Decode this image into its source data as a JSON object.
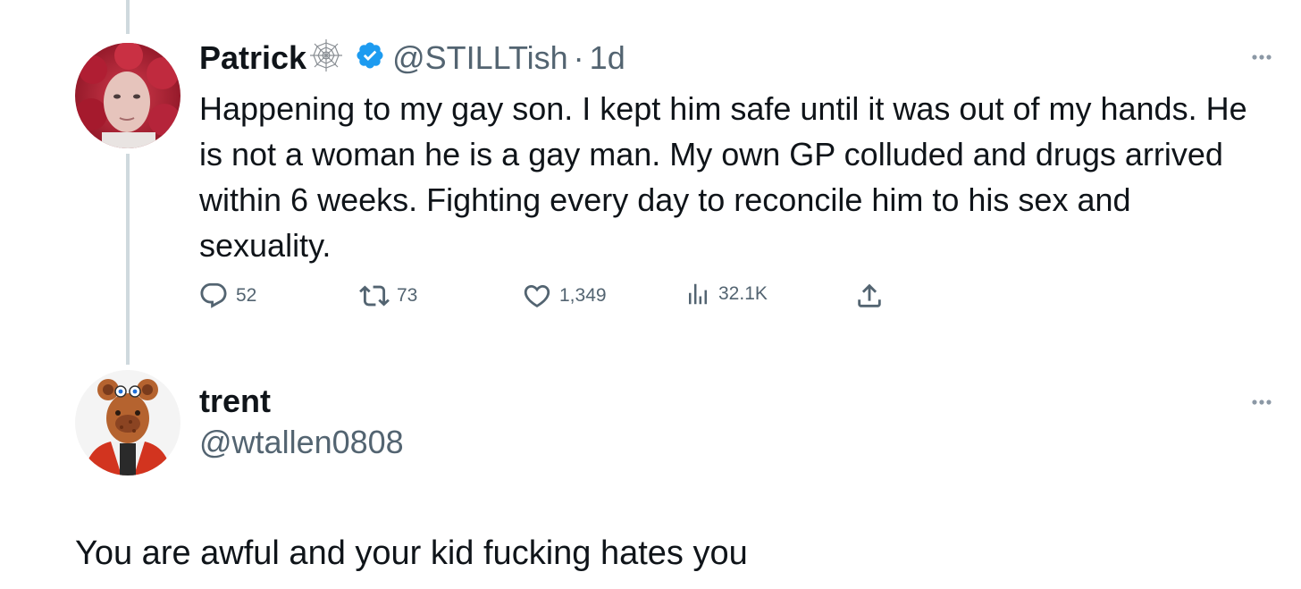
{
  "tweet": {
    "author": {
      "display_name": "Patrick",
      "name_emoji": "spider-web-icon",
      "verified_badge": "verified-badge-icon",
      "handle": "@STILLTish",
      "separator": "·",
      "timestamp": "1d"
    },
    "text": "Happening to my gay son. I kept him safe until it was out of my hands. He is not a woman he is a gay man.  My own GP colluded and drugs arrived within 6 weeks. Fighting every day to reconcile him to his sex and sexuality.",
    "actions": {
      "replies": "52",
      "retweets": "73",
      "likes": "1,349",
      "views": "32.1K"
    }
  },
  "reply": {
    "author": {
      "display_name": "trent",
      "handle": "@wtallen0808"
    },
    "text": "You are awful and your kid fucking hates you"
  },
  "colors": {
    "text_primary": "#0f1419",
    "text_secondary": "#536471",
    "verified_blue": "#1d9bf0",
    "thread_line": "#cfd9de"
  }
}
